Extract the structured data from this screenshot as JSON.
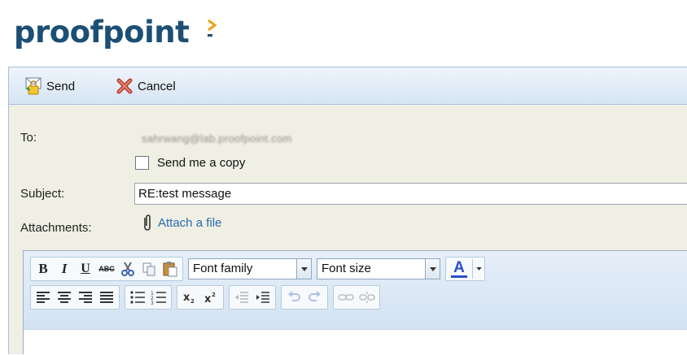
{
  "header": {
    "logo_text": "proofpoint"
  },
  "toolbar": {
    "send_label": "Send",
    "cancel_label": "Cancel"
  },
  "form": {
    "to_label": "To:",
    "to_value": "sahrwang@lab.proofpoint.com",
    "copy_label": "Send me a copy",
    "copy_checked": false,
    "subject_label": "Subject:",
    "subject_value": "RE:test message",
    "attachments_label": "Attachments:",
    "attach_link": "Attach a file"
  },
  "editor": {
    "font_family": "Font family",
    "font_size": "Font size",
    "bold": "B",
    "italic": "I",
    "underline": "U",
    "strike": "ABC",
    "text_color_glyph": "A"
  },
  "colors": {
    "logo": "#1c4f74",
    "toolbar_bg": "#dce8f5",
    "form_bg": "#efefe3",
    "link": "#2a6cb0",
    "text_color_bar": "#2a4fc9"
  }
}
